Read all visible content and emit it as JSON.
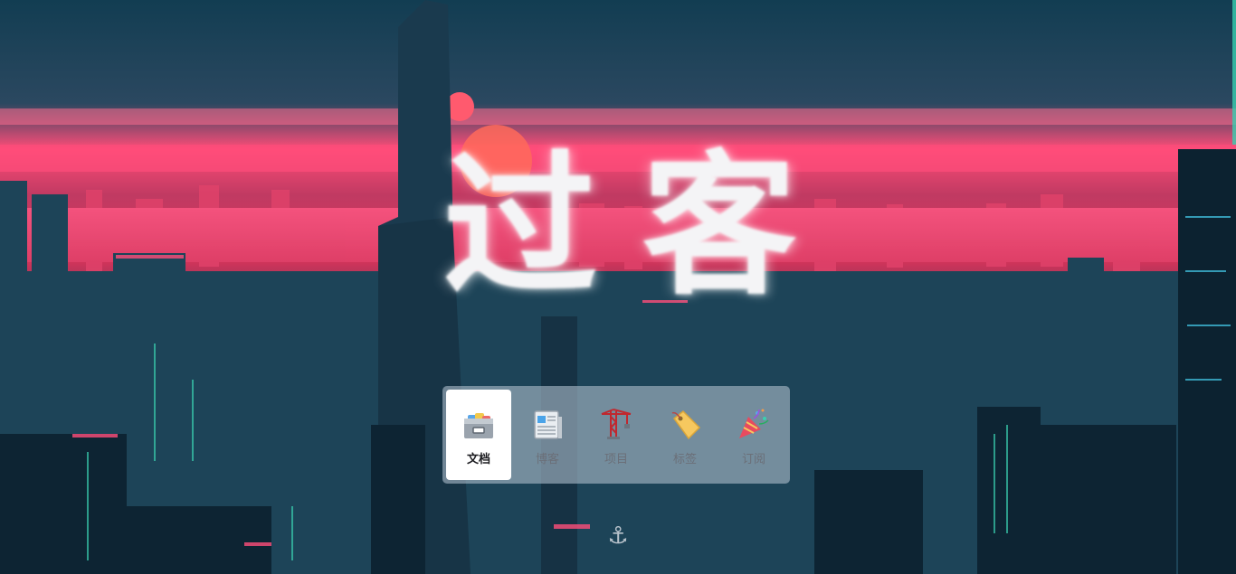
{
  "hero": {
    "title_left": "过",
    "title_right": "客"
  },
  "nav": {
    "items": [
      {
        "label": "文档",
        "icon": "card-file-box-icon",
        "active": true
      },
      {
        "label": "博客",
        "icon": "newspaper-icon",
        "active": false
      },
      {
        "label": "项目",
        "icon": "construction-crane-icon",
        "active": false
      },
      {
        "label": "标签",
        "icon": "label-tag-icon",
        "active": false
      },
      {
        "label": "订阅",
        "icon": "party-popper-icon",
        "active": false
      }
    ]
  },
  "footer": {
    "anchor_glyph": "⚓",
    "anchor_icon": "anchor-icon"
  },
  "colors": {
    "sky_top": "#133a4f",
    "glow": "#ff4d7a",
    "city": "#12384a",
    "nav_bg": "#aab9c8"
  }
}
